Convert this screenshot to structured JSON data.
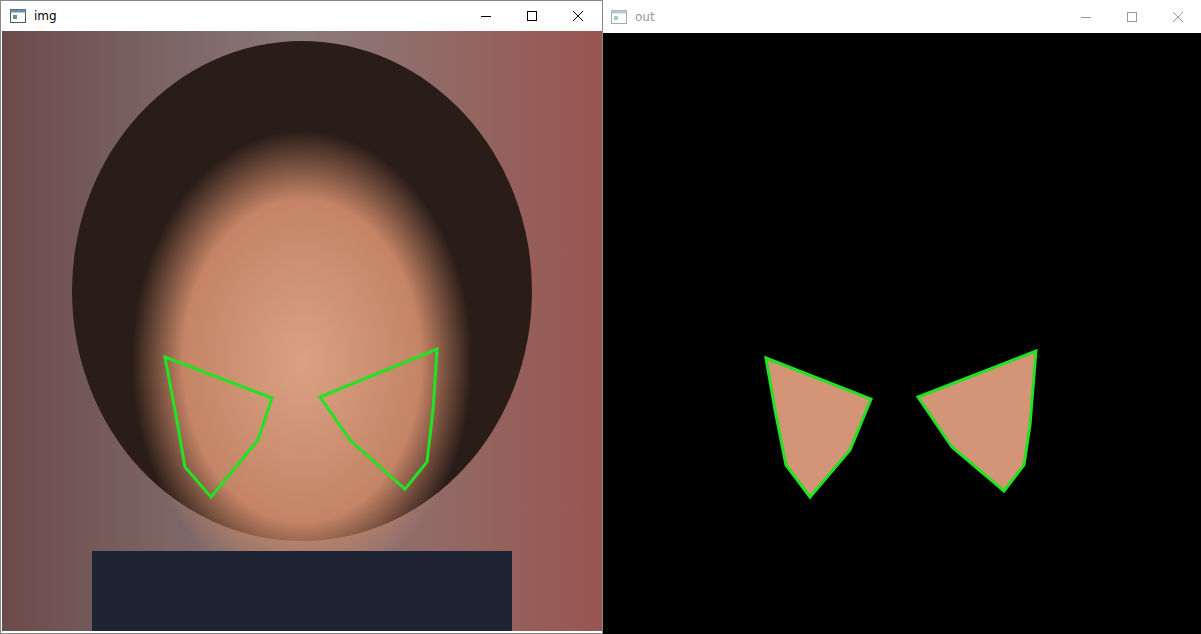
{
  "windows": [
    {
      "title": "img",
      "active": true,
      "kind": "photo"
    },
    {
      "title": "out",
      "active": false,
      "kind": "mask"
    }
  ]
}
